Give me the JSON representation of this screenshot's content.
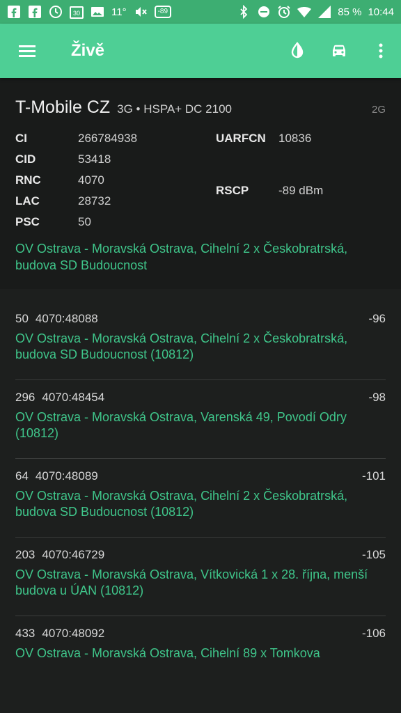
{
  "status_bar": {
    "temperature": "11°",
    "signal_badge": "-89",
    "calendar_day": "30",
    "battery": "85 %",
    "time": "10:44",
    "icons": [
      "facebook-icon",
      "facebook-icon",
      "circle-icon",
      "calendar-icon",
      "image-icon",
      "mute-icon",
      "bluetooth-icon",
      "dnd-icon",
      "alarm-icon",
      "wifi-icon",
      "cell-signal-icon",
      "battery-icon"
    ]
  },
  "appbar": {
    "title": "Živě",
    "icons": [
      "menu-icon",
      "brightness-icon",
      "car-icon",
      "more-vert-icon"
    ]
  },
  "serving": {
    "operator": "T-Mobile CZ",
    "tech": "3G • HSPA+ DC 2100",
    "other_tech": "2G",
    "left_params": [
      {
        "key": "CI",
        "value": "266784938"
      },
      {
        "key": "CID",
        "value": "53418"
      },
      {
        "key": "RNC",
        "value": "4070"
      },
      {
        "key": "LAC",
        "value": "28732"
      },
      {
        "key": "PSC",
        "value": "50"
      }
    ],
    "right_params": [
      {
        "key": "UARFCN",
        "value": "10836"
      },
      {
        "key": "RSCP",
        "value": "-89 dBm"
      }
    ],
    "address": "OV Ostrava - Moravská Ostrava, Cihelní 2 x Českobratrská, budova SD Budoucnost"
  },
  "neighbours": [
    {
      "psc": "50",
      "id": "4070:48088",
      "signal": "-96",
      "address": "OV Ostrava - Moravská Ostrava, Cihelní 2 x Českobratrská, budova SD Budoucnost (10812)"
    },
    {
      "psc": "296",
      "id": "4070:48454",
      "signal": "-98",
      "address": "OV Ostrava - Moravská Ostrava, Varenská 49, Povodí Odry (10812)"
    },
    {
      "psc": "64",
      "id": "4070:48089",
      "signal": "-101",
      "address": "OV Ostrava - Moravská Ostrava, Cihelní 2 x Českobratrská, budova SD Budoucnost (10812)"
    },
    {
      "psc": "203",
      "id": "4070:46729",
      "signal": "-105",
      "address": "OV Ostrava - Moravská Ostrava, Vítkovická 1 x 28. října, menší budova u ÚAN (10812)"
    },
    {
      "psc": "433",
      "id": "4070:48092",
      "signal": "-106",
      "address": "OV Ostrava - Moravská Ostrava, Cihelní 89 x Tomkova"
    }
  ],
  "colors": {
    "statusbar": "#3dae72",
    "appbar": "#4ecf95",
    "accent_text": "#3fc58a",
    "background": "#1d1f1e"
  }
}
